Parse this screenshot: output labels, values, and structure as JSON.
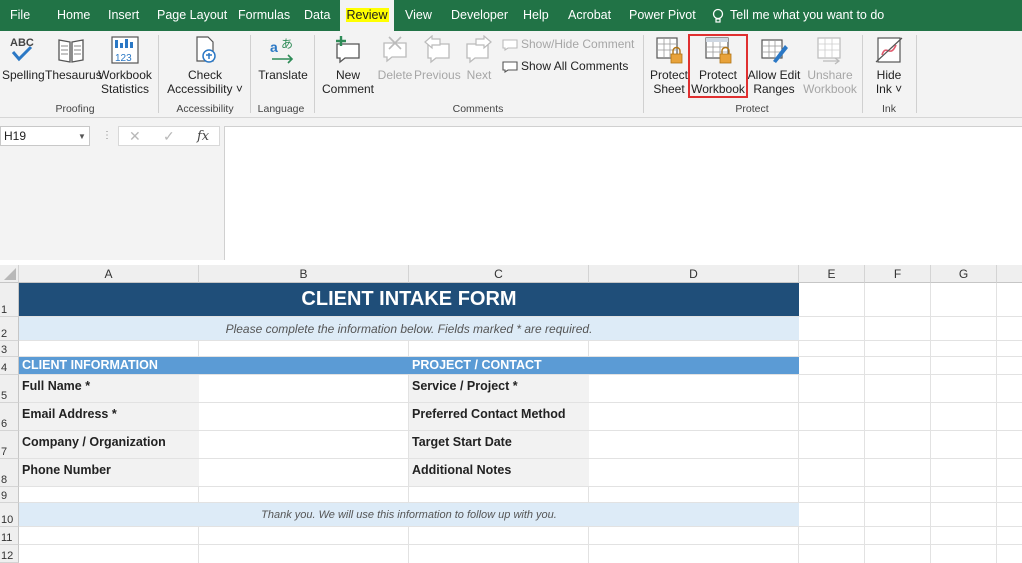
{
  "menu": {
    "tabs": [
      "File",
      "Home",
      "Insert",
      "Page Layout",
      "Formulas",
      "Data",
      "Review",
      "View",
      "Developer",
      "Help",
      "Acrobat",
      "Power Pivot"
    ],
    "active_tab": "Review",
    "tell_me": "Tell me what you want to do"
  },
  "ribbon": {
    "proofing": {
      "label": "Proofing",
      "spelling": "Spelling",
      "thesaurus": "Thesaurus",
      "workbook_stats_1": "Workbook",
      "workbook_stats_2": "Statistics",
      "abc": "ABC",
      "num123": "123"
    },
    "accessibility": {
      "label": "Accessibility",
      "check_1": "Check",
      "check_2": "Accessibility ˅"
    },
    "language": {
      "label": "Language",
      "translate": "Translate"
    },
    "comments": {
      "label": "Comments",
      "new_1": "New",
      "new_2": "Comment",
      "delete": "Delete",
      "previous": "Previous",
      "next": "Next",
      "show_hide": "Show/Hide Comment",
      "show_all": "Show All Comments"
    },
    "protect": {
      "label": "Protect",
      "sheet_1": "Protect",
      "sheet_2": "Sheet",
      "workbook_1": "Protect",
      "workbook_2": "Workbook",
      "allow_1": "Allow Edit",
      "allow_2": "Ranges",
      "unshare_1": "Unshare",
      "unshare_2": "Workbook"
    },
    "ink": {
      "label": "Ink",
      "hide_1": "Hide",
      "hide_2": "Ink ˅"
    }
  },
  "formula_bar": {
    "name_box": "H19",
    "fx": "fx",
    "cancel": "✕",
    "enter": "✓",
    "formula": ""
  },
  "sheet": {
    "columns": [
      "A",
      "B",
      "C",
      "D",
      "E",
      "F",
      "G"
    ],
    "rows": [
      "1",
      "2",
      "3",
      "4",
      "5",
      "6",
      "7",
      "8",
      "9",
      "10",
      "11",
      "12"
    ],
    "title": "CLIENT INTAKE FORM",
    "subtitle": "Please complete the information below. Fields marked * are required.",
    "client_header": "CLIENT INFORMATION",
    "project_header": "PROJECT / CONTACT",
    "left_labels": [
      "Full Name *",
      "Email Address *",
      "Company / Organization",
      "Phone Number"
    ],
    "right_labels": [
      "Service / Project *",
      "Preferred Contact Method",
      "Target Start Date",
      "Additional Notes"
    ],
    "footer": "Thank you. We will use this information to follow up with you."
  },
  "colors": {
    "excel_green": "#217346",
    "title_fill": "#1f4e79",
    "section_fill": "#5b9bd5",
    "light_fill": "#ddebf7",
    "label_fill": "#f2f2f2",
    "highlight_border": "#e03030",
    "active_tab_highlight": "#ffff00"
  }
}
